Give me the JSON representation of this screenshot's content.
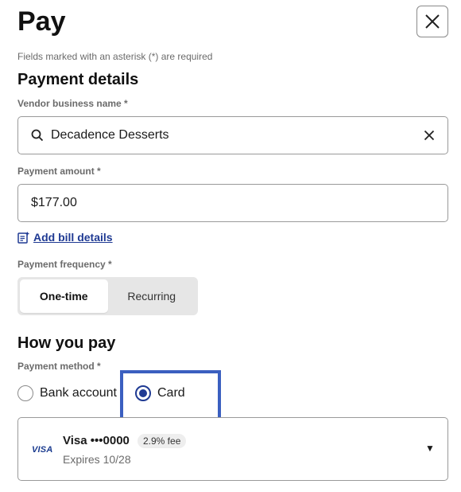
{
  "title": "Pay",
  "required_note": "Fields marked with an asterisk (*) are required",
  "payment_details": {
    "heading": "Payment details",
    "vendor_label": "Vendor business name *",
    "vendor_value": "Decadence Desserts",
    "amount_label": "Payment amount *",
    "amount_value": "$177.00",
    "add_bill_link": "Add bill details",
    "frequency_label": "Payment frequency *",
    "frequency_options": [
      "One-time",
      "Recurring"
    ],
    "frequency_selected": "One-time"
  },
  "how_you_pay": {
    "heading": "How you pay",
    "method_label": "Payment method *",
    "options": [
      "Bank account",
      "Card"
    ],
    "selected": "Card",
    "card": {
      "brand": "VISA",
      "name": "Visa •••0000",
      "fee": "2.9% fee",
      "expiry": "Expires 10/28"
    }
  },
  "colors": {
    "accent": "#1f3a93",
    "focus": "#3b5fc0"
  }
}
